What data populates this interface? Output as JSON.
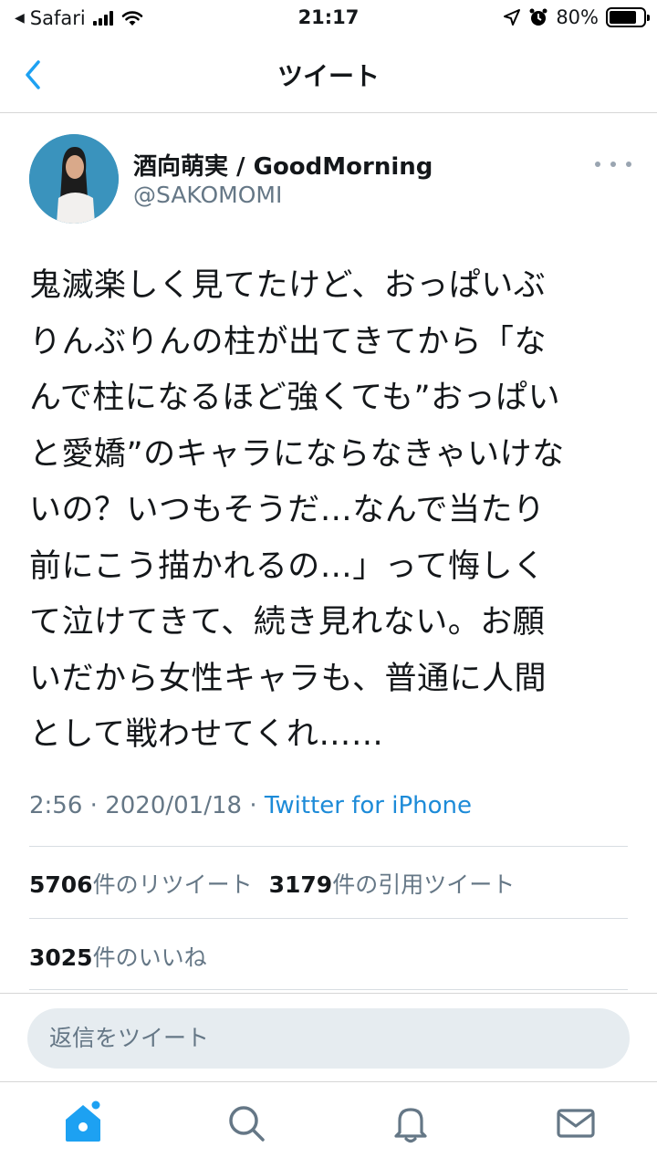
{
  "status_bar": {
    "back_app": "Safari",
    "time": "21:17",
    "battery_percent": "80%",
    "battery_level": 0.8
  },
  "nav": {
    "title": "ツイート",
    "back_icon": "chevron-left-icon"
  },
  "tweet": {
    "author_name": "酒向萌実 / GoodMorning",
    "author_handle": "@SAKOMOMI",
    "text": "鬼滅楽しく見てたけど、おっぱいぶ\nりんぶりんの柱が出てきてから「な\nんで柱になるほど強くても”おっぱい\nと愛嬌”のキャラにならなきゃいけな\nいの？いつもそうだ…なんで当たり\n前にこう描かれるの…」って悔しく\nて泣けてきて、続き見れない。お願\nいだから女性キャラも、普通に人間\nとして戦わせてくれ……",
    "time": "2:56",
    "date": "2020/01/18",
    "separator": "·",
    "source": "Twitter for iPhone"
  },
  "stats": {
    "retweets_count": "5706",
    "retweets_label": "件のリツイート",
    "quotes_count": "3179",
    "quotes_label": "件の引用ツイート",
    "likes_count": "3025",
    "likes_label": "件のいいね"
  },
  "reply": {
    "placeholder": "返信をツイート"
  },
  "tab_bar": {
    "items": [
      "home-icon",
      "search-icon",
      "notifications-icon",
      "messages-icon"
    ],
    "accent": "#1da1f2",
    "inactive": "#657786"
  }
}
